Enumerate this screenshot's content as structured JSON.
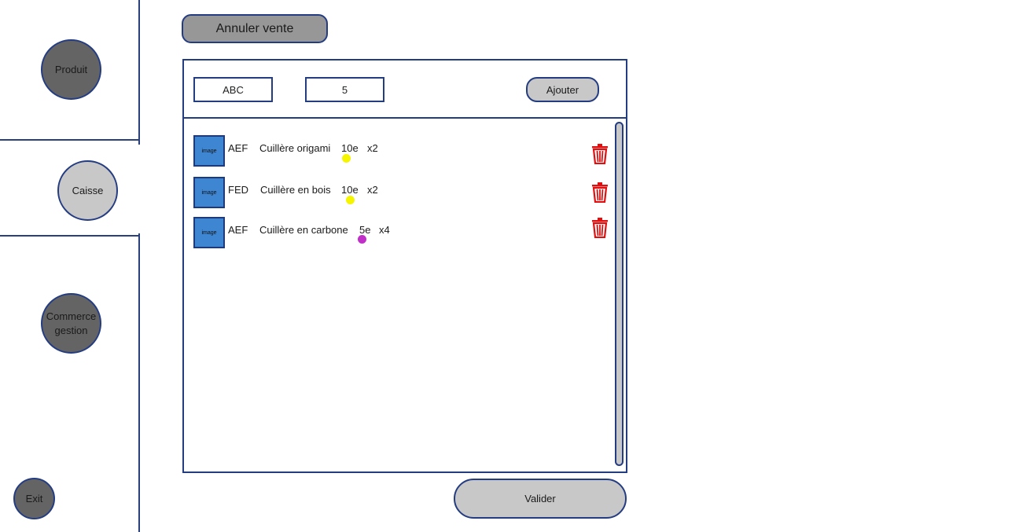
{
  "sidebar": {
    "produit": "Produit",
    "caisse": "Caisse",
    "commerce_line1": "Commerce",
    "commerce_line2": "gestion",
    "exit": "Exit"
  },
  "header": {
    "cancel_sale_label": "Annuler vente"
  },
  "entry": {
    "code_value": "ABC",
    "quantity_value": "5",
    "add_label": "Ajouter"
  },
  "items": [
    {
      "image_label": "image",
      "code": "AEF",
      "name": "Cuillère origami",
      "price": "10e",
      "qty": "x2",
      "dot_color": "#f5f500"
    },
    {
      "image_label": "image",
      "code": "FED",
      "name": "Cuillère en bois",
      "price": "10e",
      "qty": "x2",
      "dot_color": "#f5f500"
    },
    {
      "image_label": "image",
      "code": "AEF",
      "name": "Cuillère en carbone",
      "price": "5e",
      "qty": "x4",
      "dot_color": "#c030c8"
    }
  ],
  "footer": {
    "validate_label": "Valider"
  },
  "colors": {
    "border": "#243c82",
    "dark_button": "#646464",
    "light_button": "#c8c8c8",
    "thumbnail": "#3f86d2",
    "trash": "#e01010"
  }
}
